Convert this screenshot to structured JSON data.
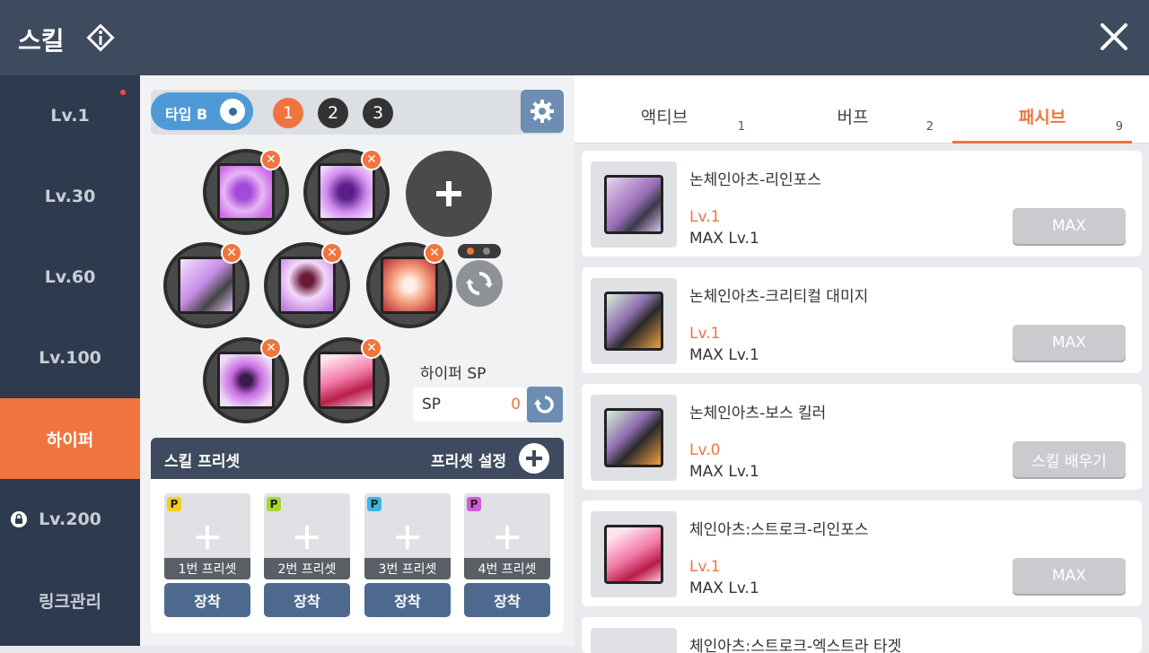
{
  "header": {
    "title": "스킬"
  },
  "sidebar": {
    "items": [
      {
        "label": "Lv.1"
      },
      {
        "label": "Lv.30"
      },
      {
        "label": "Lv.60"
      },
      {
        "label": "Lv.100"
      },
      {
        "label": "하이퍼"
      },
      {
        "label": "Lv.200"
      },
      {
        "label": "링크관리"
      }
    ]
  },
  "type_bar": {
    "toggle_label": "타입 B",
    "numbers": [
      "1",
      "2",
      "3"
    ]
  },
  "hyper_sp": {
    "label": "하이퍼 SP",
    "sp_label": "SP",
    "sp_value": "0"
  },
  "preset": {
    "title": "스킬 프리셋",
    "settings_label": "프리셋 설정",
    "items": [
      {
        "label": "1번 프리셋",
        "equip": "장착",
        "icon": "P",
        "color": "#f2cf1d"
      },
      {
        "label": "2번 프리셋",
        "equip": "장착",
        "icon": "P",
        "color": "#a8d82a"
      },
      {
        "label": "3번 프리셋",
        "equip": "장착",
        "icon": "P",
        "color": "#3bb6e6"
      },
      {
        "label": "4번 프리셋",
        "equip": "장착",
        "icon": "P",
        "color": "#d35bd6"
      }
    ]
  },
  "tabs": [
    {
      "label": "액티브",
      "count": "1"
    },
    {
      "label": "버프",
      "count": "2"
    },
    {
      "label": "패시브",
      "count": "9"
    }
  ],
  "skills": [
    {
      "name": "논체인아츠-리인포스",
      "lv": "Lv.1",
      "max": "MAX Lv.1",
      "button": "MAX"
    },
    {
      "name": "논체인아츠-크리티컬 대미지",
      "lv": "Lv.1",
      "max": "MAX Lv.1",
      "button": "MAX"
    },
    {
      "name": "논체인아츠-보스 킬러",
      "lv": "Lv.0",
      "max": "MAX Lv.1",
      "button": "스킬 배우기"
    },
    {
      "name": "체인아츠:스트로크-리인포스",
      "lv": "Lv.1",
      "max": "MAX Lv.1",
      "button": "MAX"
    },
    {
      "name": "체인아츠:스트로크-엑스트라 타겟",
      "lv": "",
      "max": "",
      "button": ""
    }
  ],
  "colors": {
    "accent": "#f0743e",
    "header": "#3e4b5e",
    "sidebar": "#2e3a4d"
  }
}
